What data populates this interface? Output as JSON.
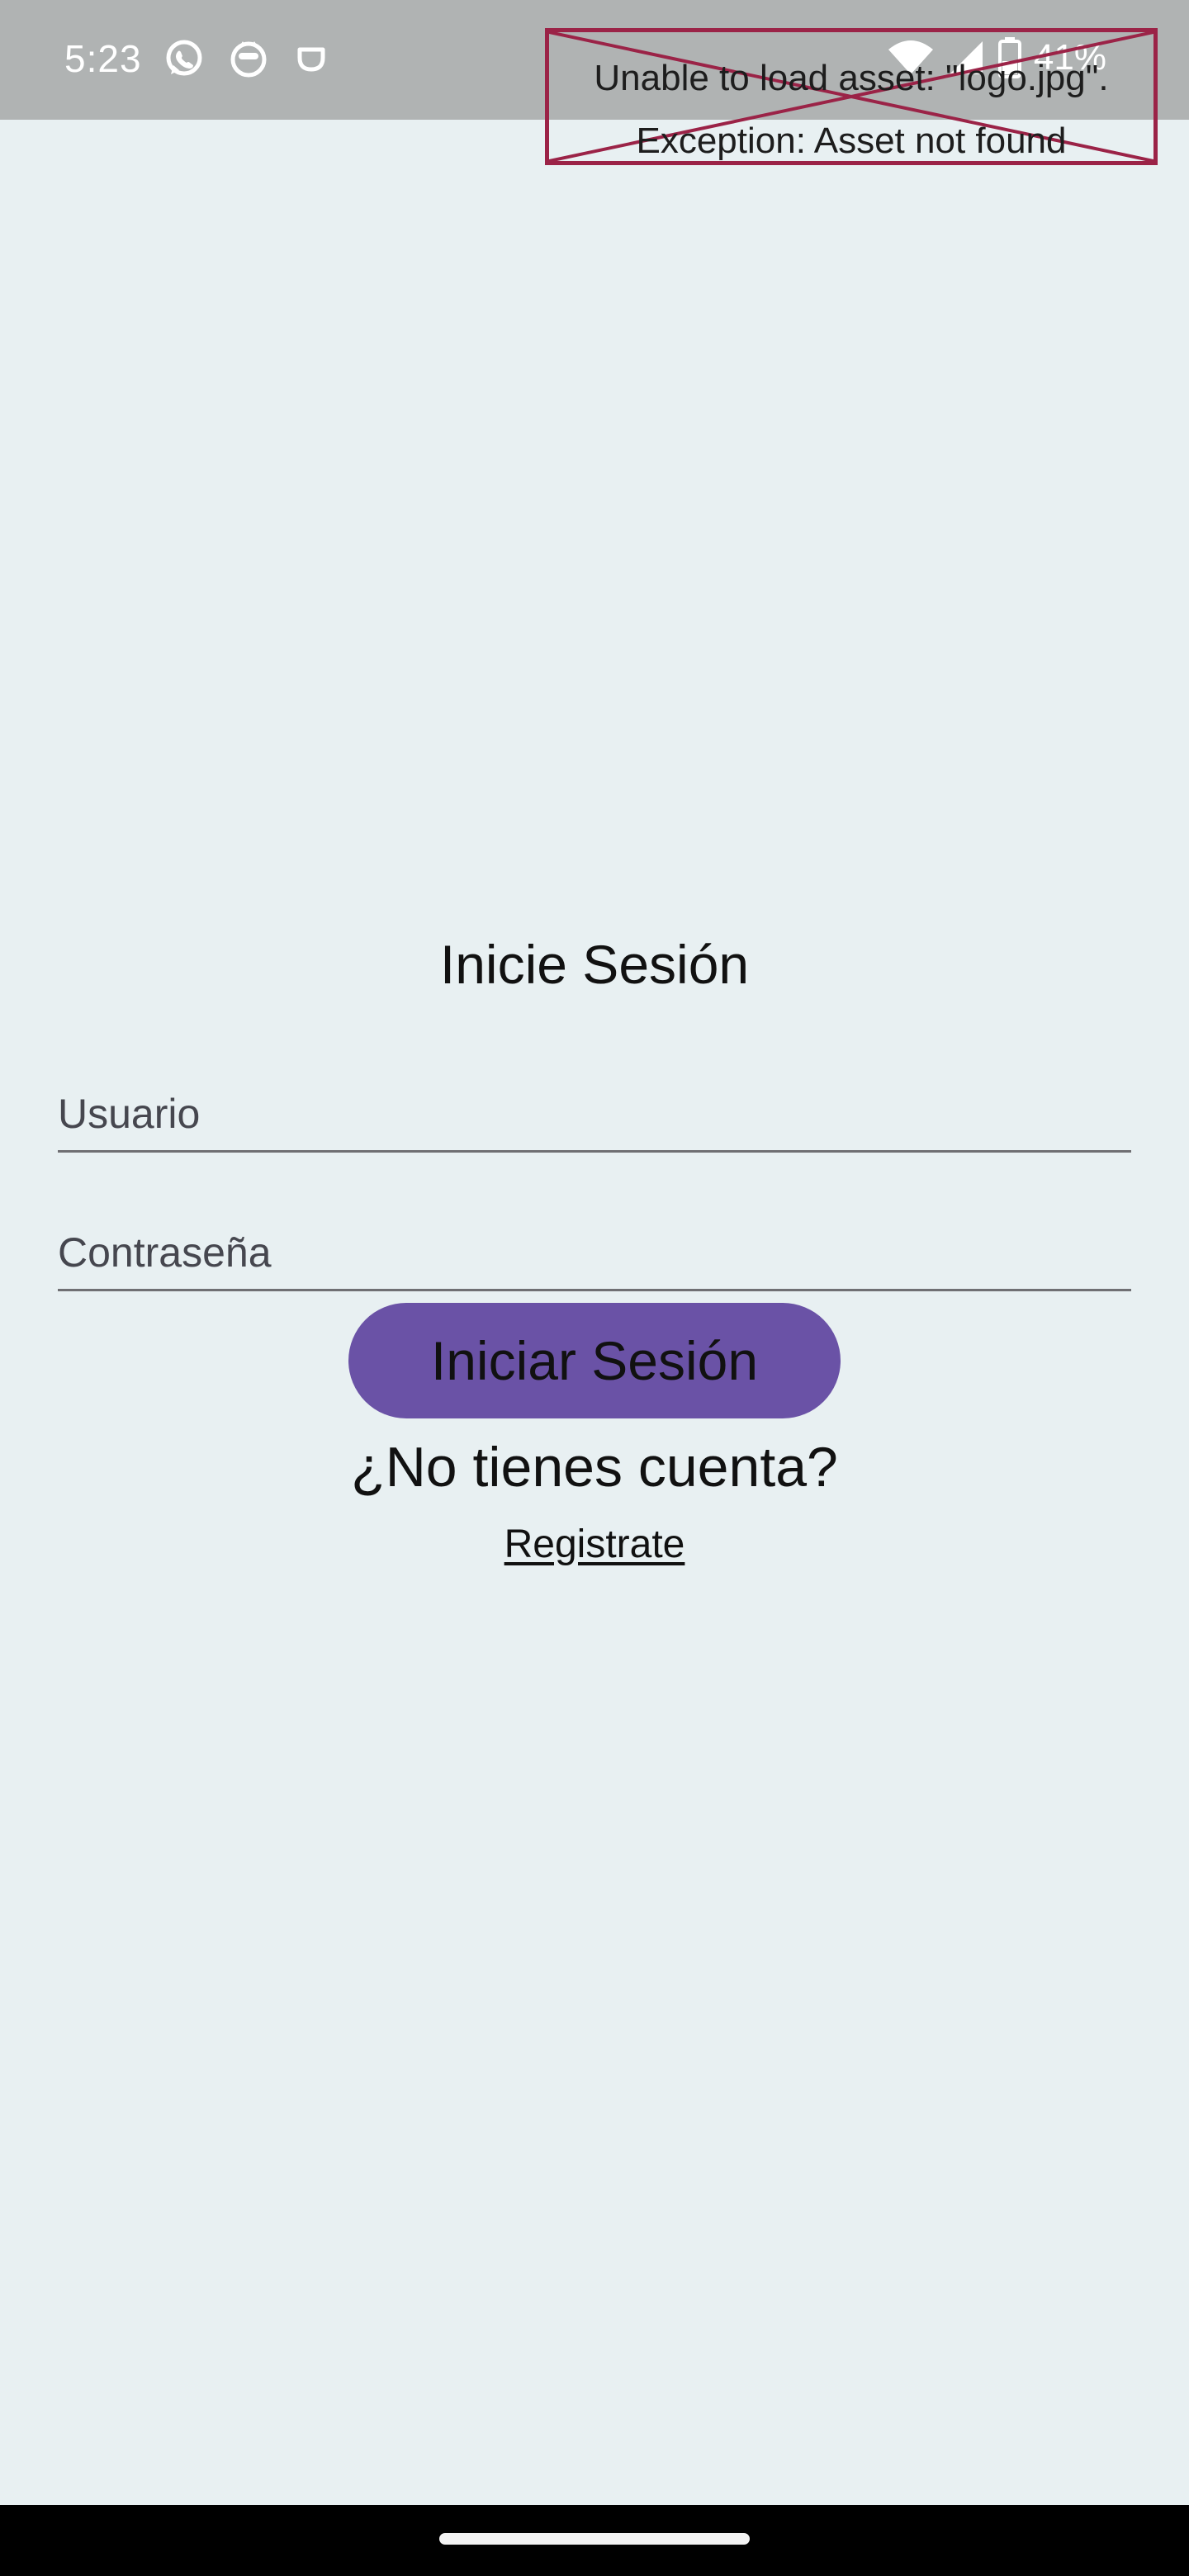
{
  "status_bar": {
    "time": "5:23",
    "left_icons": [
      "whatsapp-icon",
      "cat-app-icon",
      "cup-app-icon"
    ],
    "right_icons": [
      "wifi-icon",
      "signal-icon",
      "battery-icon"
    ],
    "battery": "41%",
    "background": "#b0b3b3"
  },
  "error_overlay": {
    "line1": "Unable to load asset: \"logo.jpg\".",
    "line2": "Exception: Asset not found",
    "border_color": "#9b2347"
  },
  "login": {
    "title": "Inicie Sesión",
    "username_label": "Usuario",
    "password_label": "Contraseña",
    "submit_label": "Iniciar Sesión",
    "no_account_text": "¿No tienes cuenta?",
    "register_link": "Registrate",
    "accent": "#6a52a6",
    "background": "#e8f0f2"
  },
  "nav": {
    "home_indicator": "home-handle"
  }
}
